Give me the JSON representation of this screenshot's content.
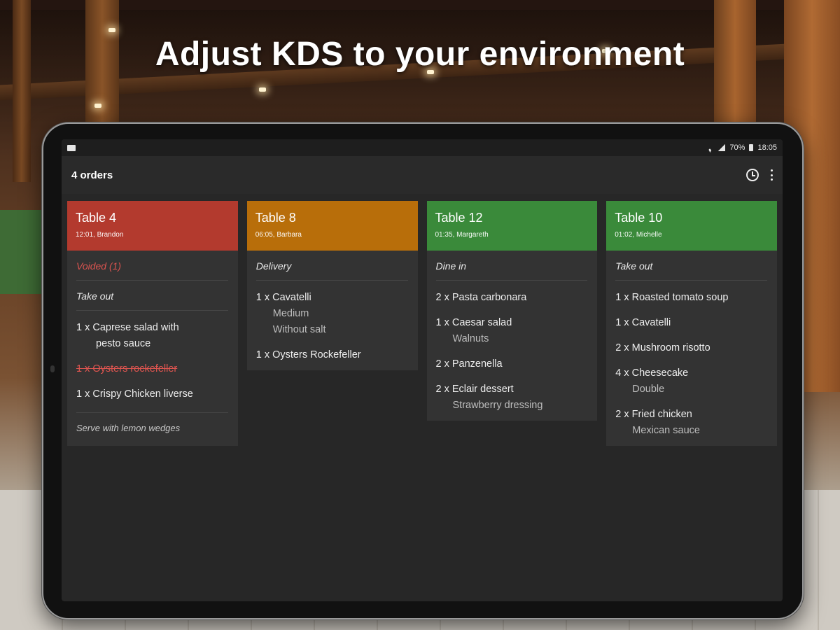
{
  "headline": "Adjust KDS to your environment",
  "statusbar": {
    "battery": "70%",
    "time": "18:05"
  },
  "appbar": {
    "title": "4 orders"
  },
  "colors": {
    "red": "#b33a2e",
    "orange": "#b86e0a",
    "green": "#3a8a3a"
  },
  "orders": [
    {
      "title": "Table 4",
      "subtitle": "12:01, Brandon",
      "color": "#b33a2e",
      "voided_label": "Voided (1)",
      "type": "Take out",
      "items": [
        {
          "text": "1 x Caprese salad with",
          "cont": "pesto sauce"
        },
        {
          "text": "1 x Oysters rockefeller"
        },
        {
          "text": "1 x Crispy Chicken liverse"
        }
      ],
      "note": "Serve with lemon wedges"
    },
    {
      "title": "Table 8",
      "subtitle": "06:05, Barbara",
      "color": "#b86e0a",
      "type": "Delivery",
      "items": [
        {
          "text": "1 x Cavatelli",
          "mods": [
            "Medium",
            "Without salt"
          ]
        },
        {
          "text": "1 x Oysters Rockefeller"
        }
      ]
    },
    {
      "title": "Table 12",
      "subtitle": "01:35, Margareth",
      "color": "#3a8a3a",
      "type": "Dine in",
      "items": [
        {
          "text": "2 x Pasta carbonara"
        },
        {
          "text": "1 x Caesar salad",
          "mods": [
            "Walnuts"
          ]
        },
        {
          "text": "2 x Panzenella"
        },
        {
          "text": "2 x Eclair dessert",
          "mods": [
            "Strawberry dressing"
          ]
        }
      ]
    },
    {
      "title": "Table 10",
      "subtitle": "01:02, Michelle",
      "color": "#3a8a3a",
      "type": "Take out",
      "items": [
        {
          "text": "1 x Roasted tomato soup"
        },
        {
          "text": "1 x Cavatelli"
        },
        {
          "text": "2 x Mushroom risotto"
        },
        {
          "text": "4 x Cheesecake",
          "mods": [
            "Double"
          ]
        },
        {
          "text": "2 x Fried chicken",
          "mods": [
            "Mexican sauce"
          ]
        }
      ]
    }
  ]
}
